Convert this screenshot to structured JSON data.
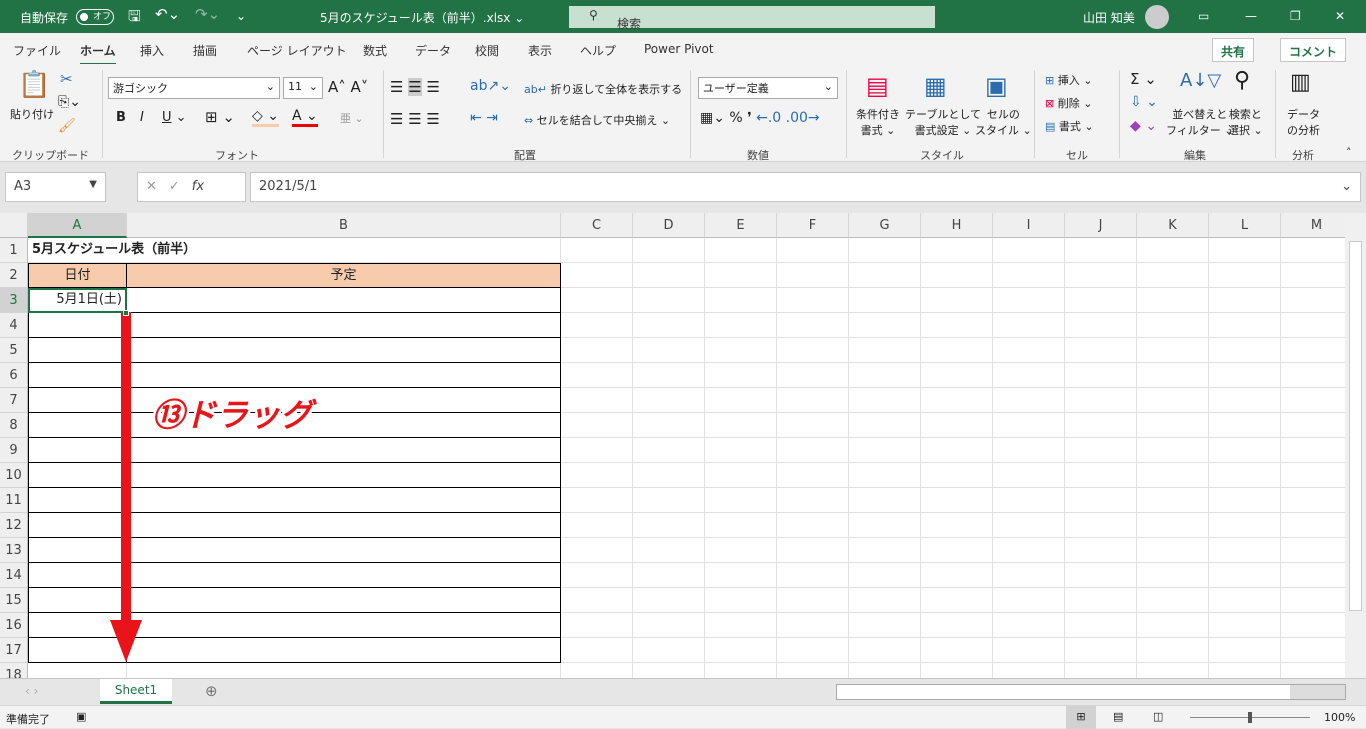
{
  "titlebar": {
    "autosave": "自動保存",
    "toggle": "オフ",
    "filename": "5月のスケジュール表（前半）.xlsx ⌄",
    "search": "検索",
    "user": "山田 知美"
  },
  "tabs": [
    "ファイル",
    "ホーム",
    "挿入",
    "描画",
    "ページ レイアウト",
    "数式",
    "データ",
    "校閲",
    "表示",
    "ヘルプ",
    "Power Pivot"
  ],
  "share": "共有",
  "comment": "コメント",
  "ribbon": {
    "paste": "貼り付け",
    "clipboard": "クリップボード",
    "font_name": "游ゴシック",
    "font_size": "11",
    "font": "フォント",
    "wrap": "折り返して全体を表示する",
    "merge": "セルを結合して中央揃え",
    "alignment": "配置",
    "number_format": "ユーザー定義",
    "number": "数値",
    "cond1": "条件付き",
    "cond2": "書式 ⌄",
    "table1": "テーブルとして",
    "table2": "書式設定 ⌄",
    "cell1": "セルの",
    "cell2": "スタイル ⌄",
    "styles": "スタイル",
    "insert": "挿入",
    "delete": "削除",
    "format": "書式",
    "cells": "セル",
    "sort1": "並べ替えと",
    "sort2": "フィルター ⌄",
    "find1": "検索と",
    "find2": "選択 ⌄",
    "editing": "編集",
    "data1": "データ",
    "data2": "の分析",
    "analysis": "分析"
  },
  "formula": {
    "namebox": "A3",
    "fx": "fx",
    "value": "2021/5/1"
  },
  "columns": [
    "A",
    "B",
    "C",
    "D",
    "E",
    "F",
    "G",
    "H",
    "I",
    "J",
    "K",
    "L",
    "M"
  ],
  "rows": [
    "1",
    "2",
    "3",
    "4",
    "5",
    "6",
    "7",
    "8",
    "9",
    "10",
    "11",
    "12",
    "13",
    "14",
    "15",
    "16",
    "17",
    "18"
  ],
  "cells": {
    "title": "5月スケジュール表（前半）",
    "h_date": "日付",
    "h_plan": "予定",
    "a3": "5月1日(土)"
  },
  "annotation": "⑬ドラッグ",
  "sheet_tab": "Sheet1",
  "status": {
    "ready": "準備完了",
    "zoom": "100%"
  },
  "colors": {
    "header_fill": "#f8cbad",
    "accent": "#217346",
    "arrow": "#e8141a"
  }
}
